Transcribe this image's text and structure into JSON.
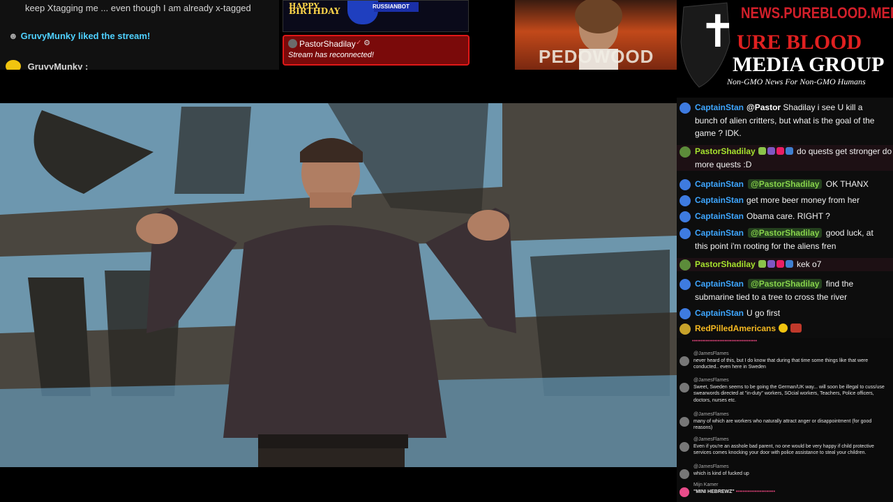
{
  "activity_feed": {
    "line1": "keep Xtagging me ... even though I am already x-tagged",
    "follow_user": "GruvyMunky",
    "follow_text": " liked the stream!",
    "chat_user": "GruvyMunky :"
  },
  "birthday_banner": {
    "line1": "HAPPY",
    "line2": "BIRTHDAY",
    "bot": "RUSSIANBOT"
  },
  "reconnect": {
    "user": "PastorShadilay",
    "message": "Stream has reconnected!"
  },
  "thumbnail": {
    "caption": "PEDOWOOD"
  },
  "logo": {
    "site": "NEWS.PUREBLOOD.MEDIA",
    "line1": "URE BLOOD",
    "line2": "MEDIA GROUP",
    "tagline": "Non-GMO News For Non-GMO Humans"
  },
  "chat": {
    "messages": [
      {
        "user": "CaptainStan",
        "mention": "@Pastor",
        "text": " Shadilay i see U kill a bunch of alien critters, but what is the goal of the game ? IDK."
      },
      {
        "user": "PastorShadilay",
        "text": "do quests get stronger do more quests :D"
      },
      {
        "user": "CaptainStan",
        "mention": "@PastorShadilay",
        "text": "OK THANX"
      },
      {
        "user": "CaptainStan",
        "text": "get more beer money from her"
      },
      {
        "user": "CaptainStan",
        "text": "Obama care. RIGHT ?"
      },
      {
        "user": "CaptainStan",
        "mention": "@PastorShadilay",
        "text": "good luck, at this point i'm rooting for the aliens fren"
      },
      {
        "user": "PastorShadilay",
        "text": "kek o7"
      },
      {
        "user": "CaptainStan",
        "mention": "@PastorShadilay",
        "text": "find the submarine tied to a tree to cross the river"
      },
      {
        "user": "CaptainStan",
        "text": "U go first"
      },
      {
        "user": "RedPilledAmericans",
        "text": ""
      }
    ]
  },
  "chat2": {
    "messages": [
      {
        "user": "@JamesFlames",
        "text": "never heard of this, but I do know that during that time some things like that were conducted.. even here in Sweden"
      },
      {
        "user": "@JamesFlames",
        "text": "Sweet, Sweden seems to be going the German/UK way... will soon be illegal to cuss/use swearwords directed at \"in-duty\" workers, SOcial workers, Teachers, Police officers, doctors, nurses etc."
      },
      {
        "user": "@JamesFlames",
        "text": "many of which are workers who naturally attract anger or disappointment (for good reasons)"
      },
      {
        "user": "@JamesFlames",
        "text": "Even if you're an asshole bad parent, no one would be very happy if child protective services comes knocking your door with police assistance to steal your children."
      },
      {
        "user": "@JamesFlames",
        "text": "which is kind of fucked up"
      },
      {
        "user": "Mijn Kamer",
        "text": "\"MINI HEBREWZ\""
      }
    ]
  },
  "colors": {
    "captain": "#3ea6ff",
    "pastor": "#a6e22e",
    "redpilled": "#f5b921",
    "alert_border": "#e01818"
  }
}
